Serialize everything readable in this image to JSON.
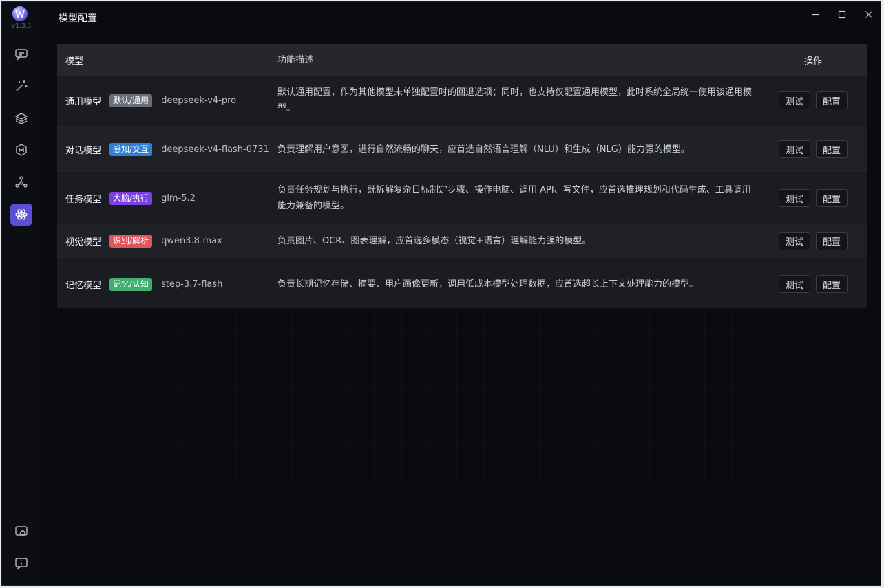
{
  "app": {
    "version": "v1.3.3",
    "title": "模型配置"
  },
  "table": {
    "headers": {
      "model": "模型",
      "desc": "功能描述",
      "actions": "操作"
    },
    "rows": [
      {
        "name": "通用模型",
        "tag": "默认/通用",
        "tag_color": "#6b6e78",
        "model_id": "deepseek-v4-pro",
        "desc": "默认通用配置，作为其他模型未单独配置时的回退选项；同时，也支持仅配置通用模型，此时系统全局统一使用该通用模型。",
        "height": 70
      },
      {
        "name": "对话模型",
        "tag": "感知/交互",
        "tag_color": "#2f7fd6",
        "model_id": "deepseek-v4-flash-0731",
        "desc": "负责理解用户意图，进行自然流畅的聊天，应首选自然语言理解（NLU）和生成（NLG）能力强的模型。",
        "height": 70
      },
      {
        "name": "任务模型",
        "tag": "大脑/执行",
        "tag_color": "#7b3fe4",
        "model_id": "glm-5.2",
        "desc": "负责任务规划与执行，既拆解复杂目标制定步骤、操作电脑、调用 API、写文件，应首选推理规划和代码生成、工具调用能力兼备的模型。",
        "height": 70
      },
      {
        "name": "视觉模型",
        "tag": "识别/解析",
        "tag_color": "#e0545a",
        "model_id": "qwen3.8-max",
        "desc": "负责图片、OCR、图表理解，应首选多模态（视觉+语言）理解能力强的模型。",
        "height": 53
      },
      {
        "name": "记忆模型",
        "tag": "记忆/认知",
        "tag_color": "#3fae6e",
        "model_id": "step-3.7-flash",
        "desc": "负责长期记忆存储、摘要、用户画像更新，调用低成本模型处理数据，应首选超长上下文处理能力的模型。",
        "height": 70
      }
    ],
    "test_label": "测试",
    "config_label": "配置"
  }
}
